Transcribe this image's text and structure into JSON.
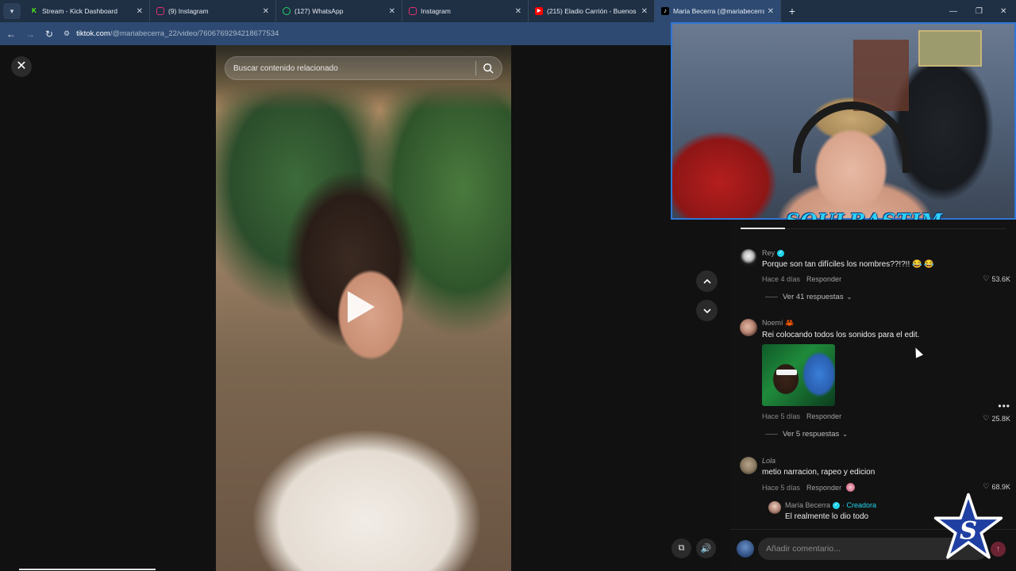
{
  "browser": {
    "tabs": [
      {
        "title": "Stream - Kick Dashboard",
        "favicon": "kick-icon",
        "color": "#53fc18",
        "active": false
      },
      {
        "title": "(9) Instagram",
        "favicon": "instagram-icon",
        "color": "#e1306c",
        "active": false
      },
      {
        "title": "(127) WhatsApp",
        "favicon": "whatsapp-icon",
        "color": "#25d366",
        "active": false
      },
      {
        "title": "Instagram",
        "favicon": "instagram-icon",
        "color": "#e1306c",
        "active": false
      },
      {
        "title": "(215) Eladio Carrión - Buenos D",
        "favicon": "youtube-icon",
        "color": "#ff0000",
        "active": false
      },
      {
        "title": "Maria Becerra (@mariabecerra_",
        "favicon": "tiktok-icon",
        "color": "#ffffff",
        "active": true
      }
    ],
    "url_host": "tiktok.com",
    "url_path": "/@mariabecerra_22/video/7606769294218677534"
  },
  "video": {
    "search_placeholder": "Buscar contenido relacionado"
  },
  "webcam": {
    "overlay_text": "SOULBASTIM"
  },
  "comments": [
    {
      "user": "Rey",
      "verified": true,
      "text": "Porque son tan difíciles los nombres??!?!! 😂 😂",
      "time": "Hace 4 días",
      "reply_label": "Responder",
      "likes": "53.6K",
      "view_replies": "Ver 41 respuestas"
    },
    {
      "user": "Noemí 🦀",
      "text": "Rei colocando todos los sonidos para el edit.",
      "time": "Hace 5 días",
      "reply_label": "Responder",
      "likes": "25.8K",
      "view_replies": "Ver 5 respuestas"
    },
    {
      "user": "Lola",
      "text": "metio narracion, rapeo y edicion",
      "time": "Hace 5 días",
      "reply_label": "Responder",
      "likes": "68.9K"
    },
    {
      "user": "María Becerra",
      "creator_label": "· Creadora",
      "text": "El realmente lo dio todo"
    }
  ],
  "comment_input": {
    "placeholder": "Añadir comentario..."
  }
}
